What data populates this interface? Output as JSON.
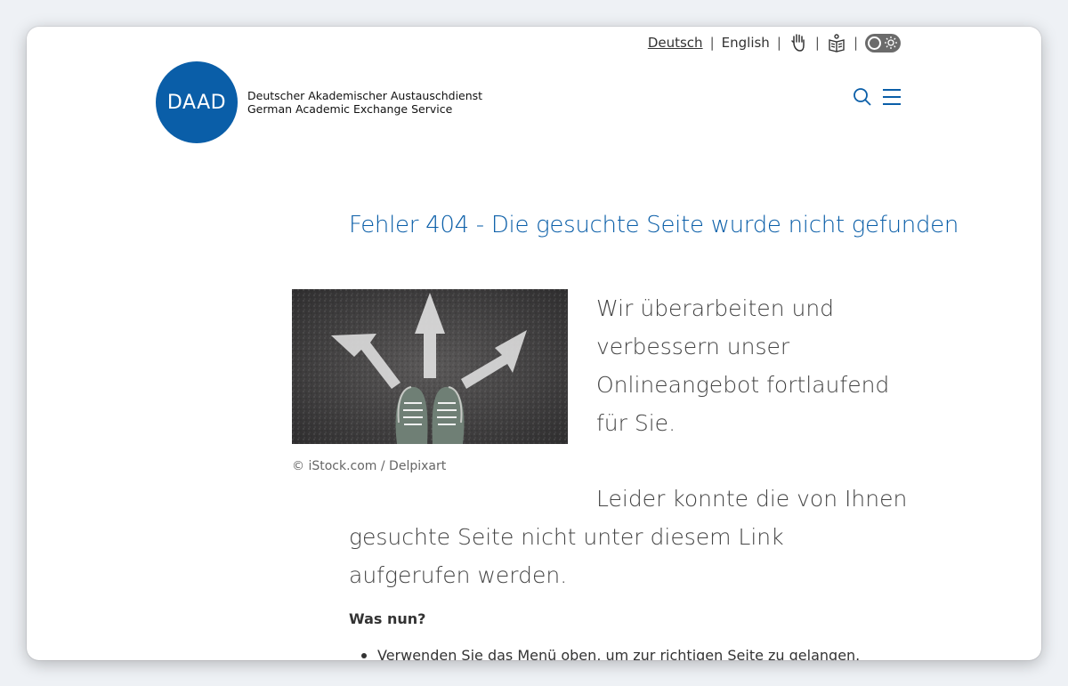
{
  "utility": {
    "lang_de": "Deutsch",
    "lang_en": "English",
    "separator": "|"
  },
  "logo": {
    "mark": "DAAD",
    "name_de": "Deutscher Akademischer Austauschdienst",
    "name_en": "German Academic Exchange Service"
  },
  "main": {
    "heading": "Fehler 404 - Die gesuchte Seite wurde nicht gefunden",
    "image_credit": "© iStock.com / Delpixart",
    "lead_paragraph": "Wir überarbeiten und verbessern unser Onlineangebot fortlaufend für Sie.",
    "second_paragraph_start": "Leider konnte die von Ihnen",
    "second_paragraph_rest": "gesuchte Seite nicht unter diesem Link aufgerufen werden.",
    "subheading": "Was nun?",
    "list_items": [
      "Verwenden Sie das Menü oben, um zur richtigen Seite zu gelangen."
    ]
  },
  "icons": {
    "accessibility": "hand-sign-icon",
    "easy_language": "book-reader-icon",
    "theme": "dark-mode-toggle",
    "search": "search-icon",
    "menu": "menu-icon"
  },
  "colors": {
    "brand_blue": "#0a5ea8",
    "text": "#444444"
  }
}
